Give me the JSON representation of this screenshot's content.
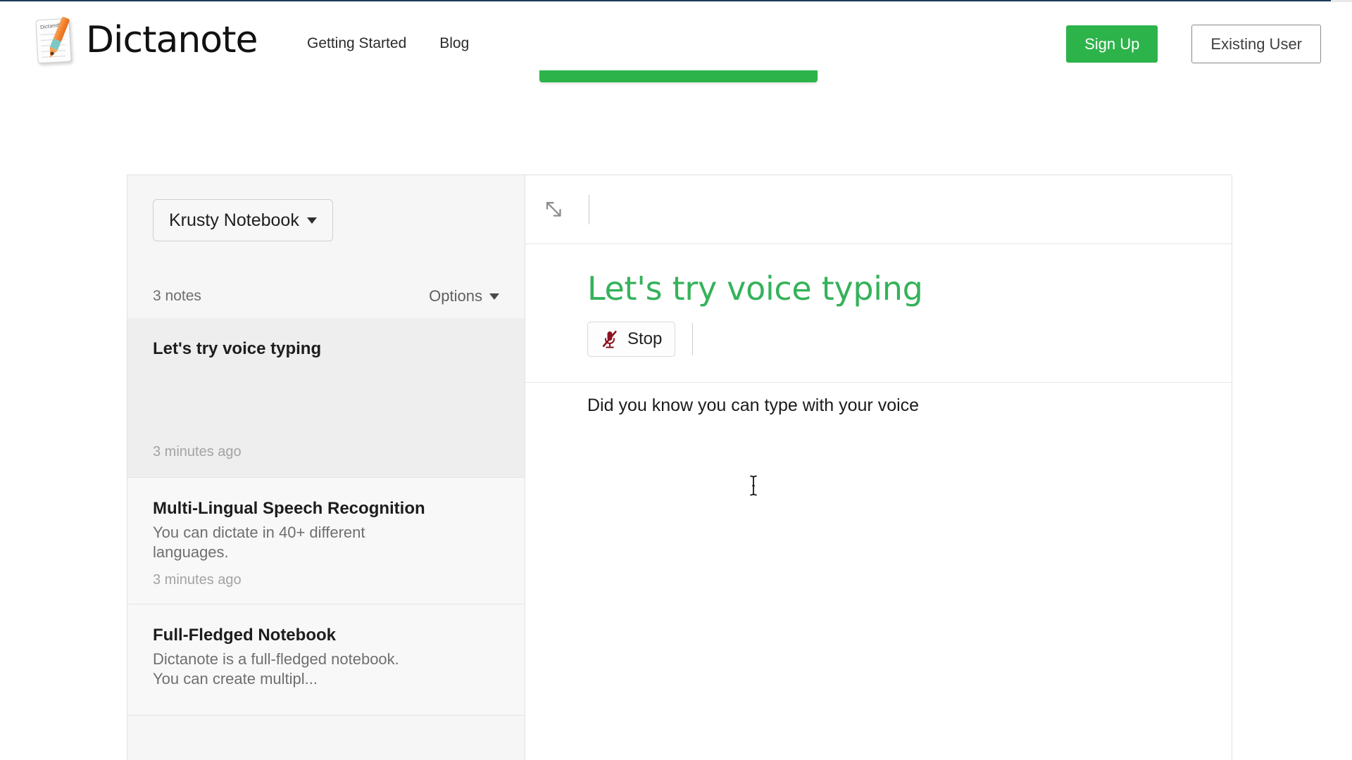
{
  "header": {
    "logo_text": "Dictanote",
    "logo_pad_label": "Dictanote",
    "nav": [
      {
        "label": "Getting Started"
      },
      {
        "label": "Blog"
      }
    ],
    "sign_up_label": "Sign Up",
    "existing_user_label": "Existing User",
    "accent_green": "#2cb34a"
  },
  "banner": {
    "color": "#2cb34a"
  },
  "sidebar": {
    "notebook_name": "Krusty Notebook",
    "notes_count_label": "3 notes",
    "options_label": "Options",
    "notes": [
      {
        "title": "Let's try voice typing",
        "snippet": "",
        "time": "3 minutes ago",
        "selected": true
      },
      {
        "title": "Multi-Lingual Speech Recognition",
        "snippet": "You can dictate in 40+ different languages.",
        "time": "3 minutes ago",
        "selected": false
      },
      {
        "title": "Full-Fledged Notebook",
        "snippet": "Dictanote is a full-fledged notebook. You can create multipl...",
        "time": "",
        "selected": false
      }
    ]
  },
  "editor": {
    "expand_icon": "expand-arrows-icon",
    "note_title": "Let's try voice typing",
    "note_title_color": "#35b25a",
    "stop_label": "Stop",
    "mic_icon": "microphone-muted-icon",
    "mic_icon_color": "#8b1220",
    "note_body": "Did you know you can type with your voice"
  },
  "cursor": {
    "type": "text-ibeam-cursor"
  }
}
